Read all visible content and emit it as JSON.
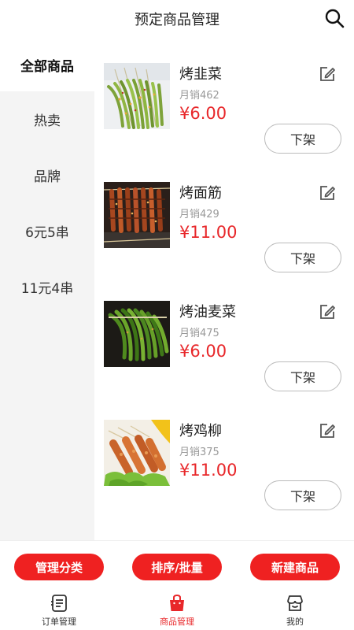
{
  "header": {
    "title": "预定商品管理",
    "search_icon": "search-icon"
  },
  "sidebar": {
    "categories": [
      {
        "label": "全部商品",
        "active": true
      },
      {
        "label": "热卖",
        "active": false
      },
      {
        "label": "品牌",
        "active": false
      },
      {
        "label": "6元5串",
        "active": false
      },
      {
        "label": "11元4串",
        "active": false
      }
    ]
  },
  "products": [
    {
      "name": "烤韭菜",
      "sales": "月销462",
      "price": "¥6.00",
      "action": "下架",
      "image": "grilled-chive-skewers-photo"
    },
    {
      "name": "烤面筋",
      "sales": "月销429",
      "price": "¥11.00",
      "action": "下架",
      "image": "grilled-gluten-skewers-photo"
    },
    {
      "name": "烤油麦菜",
      "sales": "月销475",
      "price": "¥6.00",
      "action": "下架",
      "image": "grilled-lettuce-skewers-photo"
    },
    {
      "name": "烤鸡柳",
      "sales": "月销375",
      "price": "¥11.00",
      "action": "下架",
      "image": "grilled-chicken-strip-skewers-photo"
    }
  ],
  "actions": {
    "manage_category": "管理分类",
    "sort_batch": "排序/批量",
    "new_product": "新建商品"
  },
  "tabbar": {
    "items": [
      {
        "label": "订单管理",
        "icon": "order-list-icon",
        "active": false
      },
      {
        "label": "商品管理",
        "icon": "shopping-bag-icon",
        "active": true
      },
      {
        "label": "我的",
        "icon": "store-icon",
        "active": false
      }
    ]
  },
  "colors": {
    "accent": "#e8272a",
    "button": "#ef2121",
    "sidebar_bg": "#f4f4f4"
  }
}
